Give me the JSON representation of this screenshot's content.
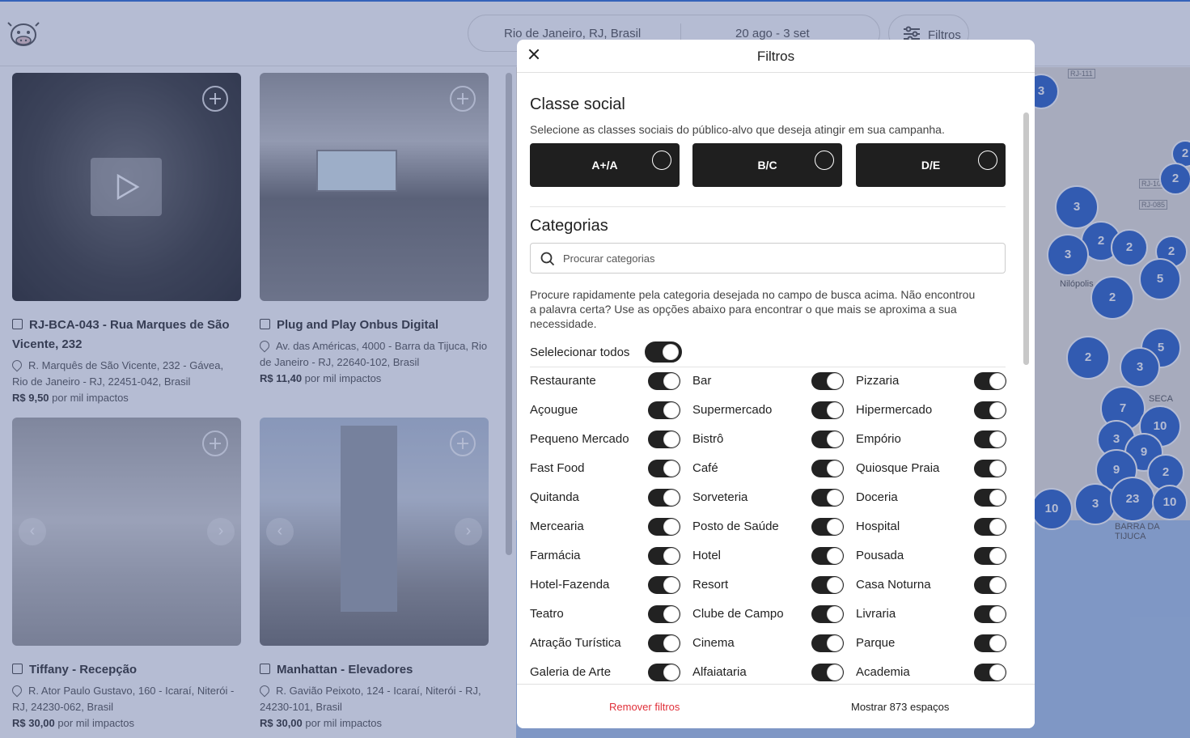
{
  "header": {
    "search_location": "Rio de Janeiro, RJ, Brasil",
    "search_dates": "20 ago - 3 set",
    "filters_label": "Filtros"
  },
  "listings": [
    {
      "title": "RJ-BCA-043 - Rua Marques de São Vicente, 232",
      "address": "R. Marquês de São Vicente, 232 - Gávea, Rio de Janeiro - RJ, 22451-042, Brasil",
      "price": "R$ 9,50",
      "price_unit": "por mil impactos"
    },
    {
      "title": "Plug and Play Onbus Digital",
      "address": "Av. das Américas, 4000 - Barra da Tijuca, Rio de Janeiro - RJ, 22640-102, Brasil",
      "price": "R$ 11,40",
      "price_unit": "por mil impactos"
    },
    {
      "title": "Tiffany - Recepção",
      "address": "R. Ator Paulo Gustavo, 160 - Icaraí, Niterói - RJ, 24230-062, Brasil",
      "price": "R$ 30,00",
      "price_unit": "por mil impactos"
    },
    {
      "title": "Manhattan - Elevadores",
      "address": "R. Gavião Peixoto, 124 - Icaraí, Niterói - RJ, 24230-101, Brasil",
      "price": "R$ 30,00",
      "price_unit": "por mil impactos"
    }
  ],
  "map": {
    "labels": [
      "RJ-111",
      "RJ-105",
      "RJ-085",
      "Nilópolis",
      "SECA",
      "BARRA DA TIJUCA"
    ],
    "clusters": [
      "3",
      "2",
      "3",
      "2",
      "2",
      "2",
      "3",
      "2",
      "5",
      "2",
      "5",
      "2",
      "3",
      "7",
      "10",
      "3",
      "9",
      "9",
      "2",
      "10",
      "3",
      "23",
      "10"
    ]
  },
  "modal": {
    "title": "Filtros",
    "social_class": {
      "heading": "Classe social",
      "description": "Selecione as classes sociais do público-alvo que deseja atingir em sua campanha.",
      "options": [
        "A+/A",
        "B/C",
        "D/E"
      ]
    },
    "categories": {
      "heading": "Categorias",
      "search_placeholder": "Procurar categorias",
      "help": "Procure rapidamente pela categoria desejada no campo de busca acima. Não encontrou a palavra certa? Use as opções abaixo para encontrar o que mais se aproxima a sua necessidade.",
      "select_all": "Selelecionar todos",
      "items": [
        "Restaurante",
        "Bar",
        "Pizzaria",
        "Açougue",
        "Supermercado",
        "Hipermercado",
        "Pequeno Mercado",
        "Bistrô",
        "Empório",
        "Fast Food",
        "Café",
        "Quiosque Praia",
        "Quitanda",
        "Sorveteria",
        "Doceria",
        "Mercearia",
        "Posto de Saúde",
        "Hospital",
        "Farmácia",
        "Hotel",
        "Pousada",
        "Hotel-Fazenda",
        "Resort",
        "Casa Noturna",
        "Teatro",
        "Clube de Campo",
        "Livraria",
        "Atração Turística",
        "Cinema",
        "Parque",
        "Galeria de Arte",
        "Alfaiataria",
        "Academia"
      ]
    },
    "footer": {
      "remove": "Remover filtros",
      "show": "Mostrar 873 espaços"
    }
  },
  "colors": {
    "accent": "#2f6fd6",
    "toggle_on": "#222222",
    "remove": "#e0303a",
    "cluster": "#2c63c8"
  }
}
